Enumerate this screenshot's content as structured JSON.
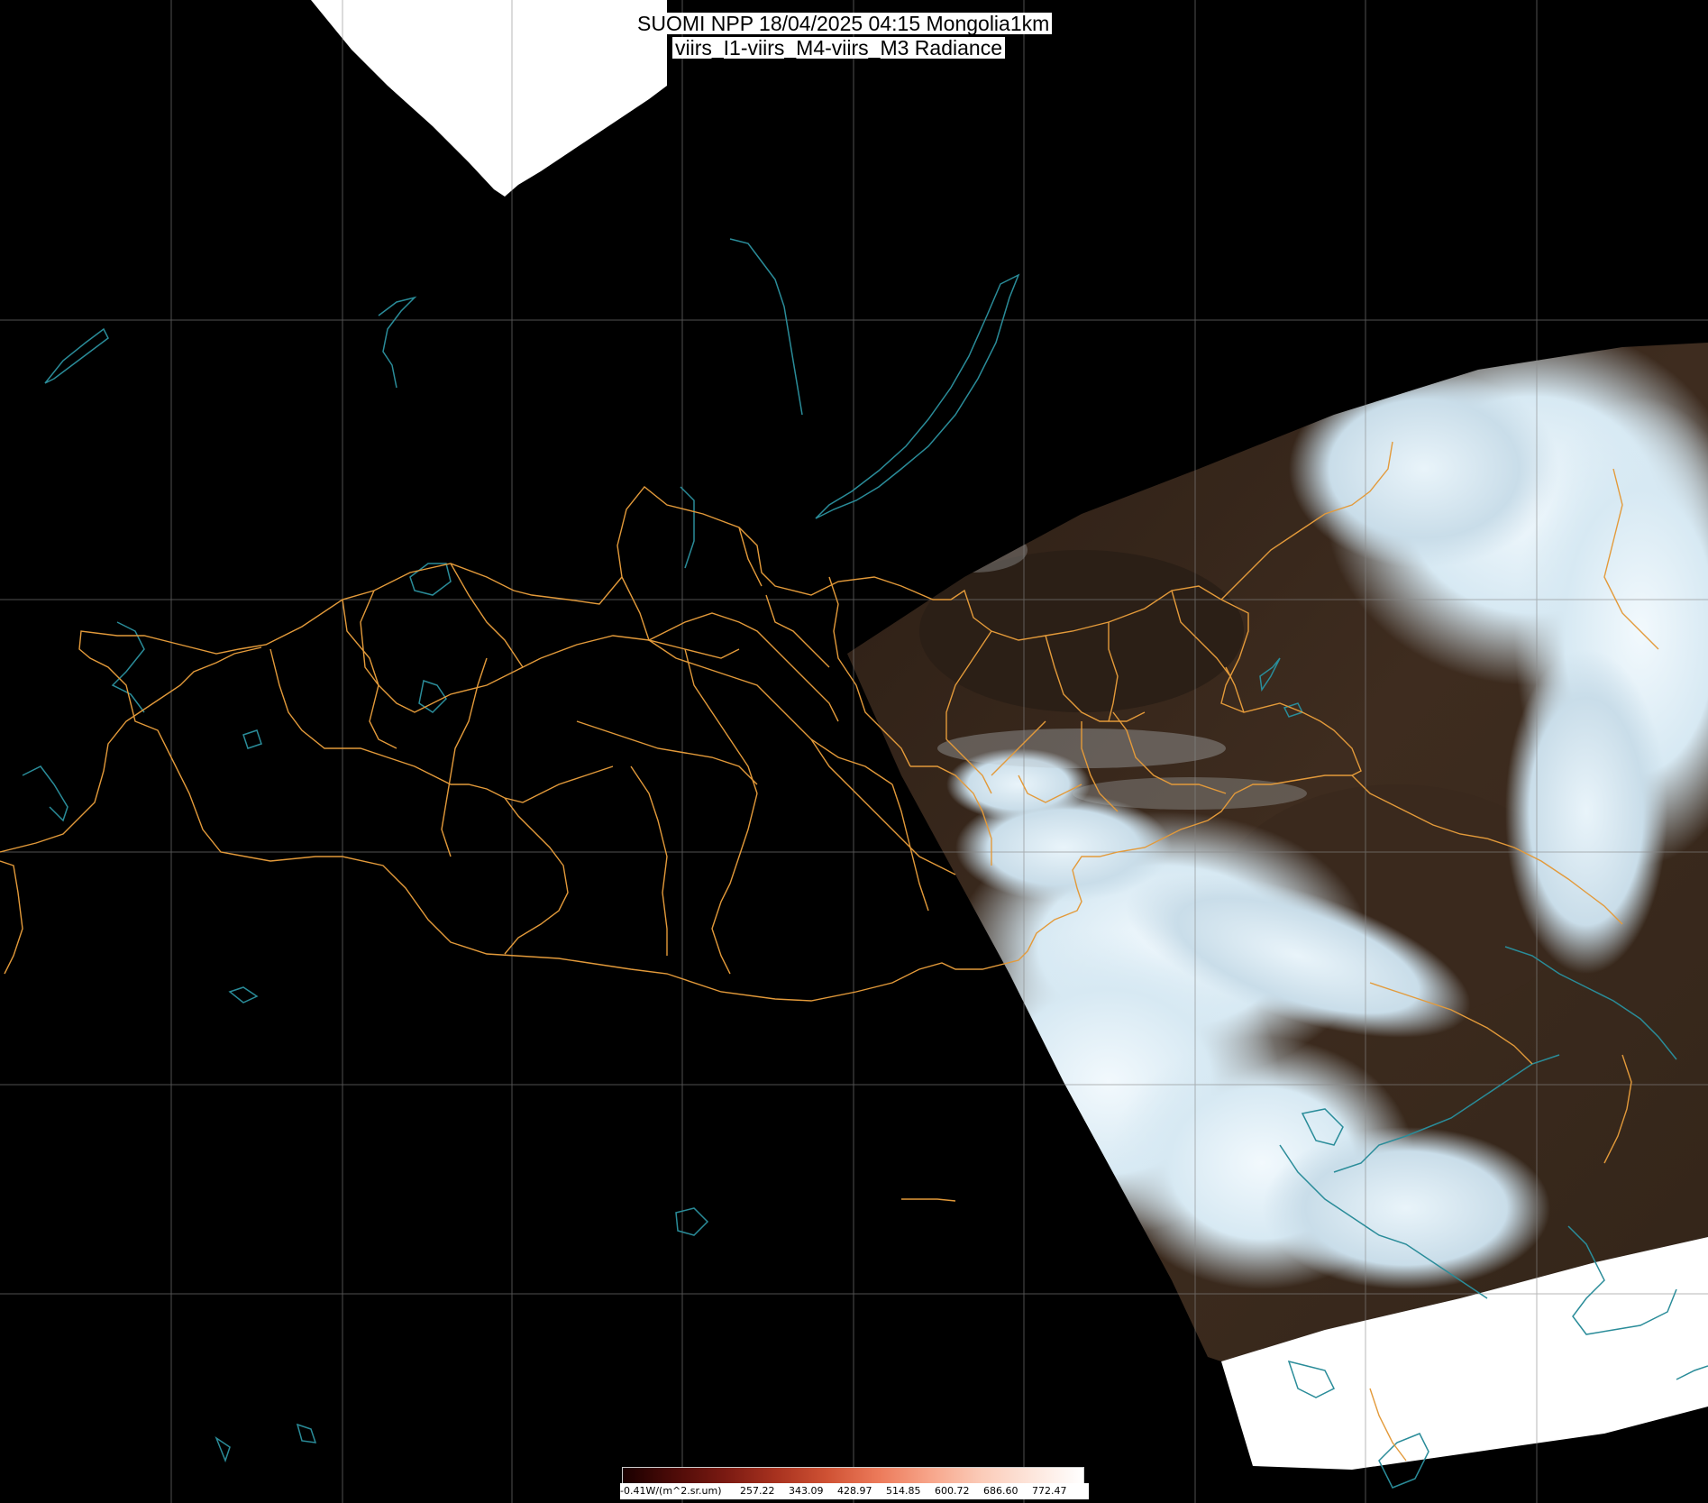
{
  "header": {
    "line1": "SUOMI NPP 18/04/2025 04:15 Mongolia1km",
    "line2": "viirs_I1-viirs_M4-viirs_M3 Radiance"
  },
  "legend": {
    "labels": [
      "-0.41W/(m^2.sr.um)",
      "257.22",
      "343.09",
      "428.97",
      "514.85",
      "600.72",
      "686.60",
      "772.47"
    ],
    "colors": [
      "#1a0000",
      "#4d0b08",
      "#7a1a12",
      "#a8321f",
      "#cf5234",
      "#ec7a5a",
      "#f7a58a",
      "#fbcbb8",
      "#fde6dc",
      "#ffffff"
    ]
  },
  "colors": {
    "border": "#e39a3a",
    "water": "#2a8c99",
    "grid": "#888888",
    "cloud": "#e8f4fb",
    "land": "#3b2a1e",
    "nodata": "#ffffff"
  },
  "map": {
    "icons": [
      "mongolia-aimag-borders",
      "lake-baikal",
      "graticule"
    ]
  }
}
